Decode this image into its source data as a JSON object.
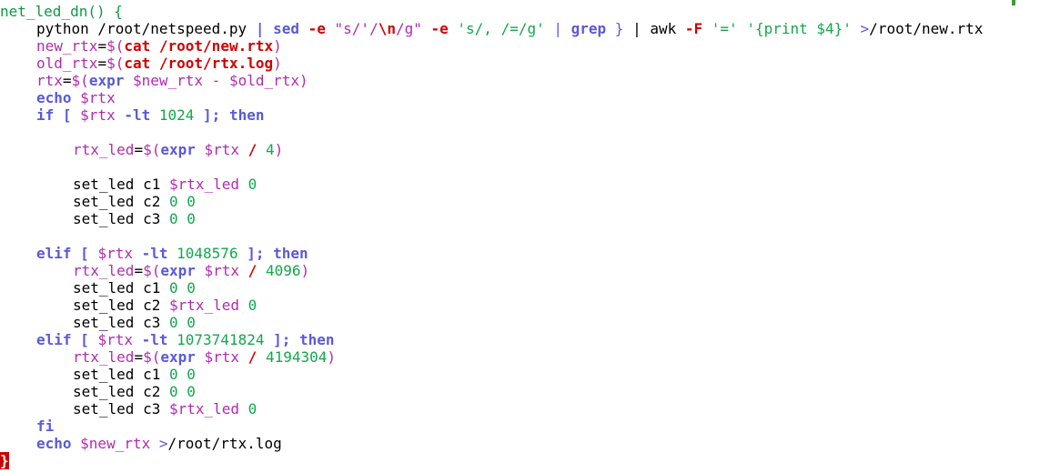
{
  "palette": {
    "background": "#ffffff",
    "default_text": "#000000",
    "function_name": "#119944",
    "keyword_command": "#5a5ad8",
    "variable": "#b02cb0",
    "string_literal": "#11a84d",
    "number": "#11a84d",
    "special_path": "#d10000",
    "cursor_background": "#cc0000"
  },
  "editor": {
    "lines": [
      {
        "indent": 0,
        "tokens": [
          [
            "net_led_dn() {",
            "function_name",
            false
          ]
        ]
      },
      {
        "indent": 4,
        "tokens": [
          [
            "python /root/netspeed.py ",
            "default_text",
            false
          ],
          [
            "| ",
            "keyword_command",
            true
          ],
          [
            "sed",
            "keyword_command",
            true
          ],
          [
            " -e ",
            "special_path",
            true
          ],
          [
            "\"s/'/",
            "variable",
            false
          ],
          [
            "\\n",
            "special_path",
            true
          ],
          [
            "/g\"",
            "variable",
            false
          ],
          [
            " -e ",
            "special_path",
            true
          ],
          [
            "'s/, /=/g'",
            "string_literal",
            false
          ],
          [
            " | ",
            "keyword_command",
            false
          ],
          [
            "grep",
            "keyword_command",
            true
          ],
          [
            " } ",
            "keyword_command",
            false
          ],
          [
            "| awk ",
            "default_text",
            false
          ],
          [
            "-F",
            "special_path",
            true
          ],
          [
            " '=' ",
            "string_literal",
            false
          ],
          [
            "'{print $4}'",
            "string_literal",
            false
          ],
          [
            " >",
            "keyword_command",
            false
          ],
          [
            "/root/new.rtx",
            "default_text",
            false
          ]
        ]
      },
      {
        "indent": 4,
        "tokens": [
          [
            "new_rtx",
            "variable",
            false
          ],
          [
            "=",
            "default_text",
            false
          ],
          [
            "$(",
            "variable",
            false
          ],
          [
            "cat",
            "special_path",
            true
          ],
          [
            " /root/new.rtx",
            "special_path",
            true
          ],
          [
            ")",
            "variable",
            false
          ]
        ]
      },
      {
        "indent": 4,
        "tokens": [
          [
            "old_rtx",
            "variable",
            false
          ],
          [
            "=",
            "default_text",
            false
          ],
          [
            "$(",
            "variable",
            false
          ],
          [
            "cat",
            "special_path",
            true
          ],
          [
            " /root/rtx.log",
            "special_path",
            true
          ],
          [
            ")",
            "variable",
            false
          ]
        ]
      },
      {
        "indent": 4,
        "tokens": [
          [
            "rtx",
            "variable",
            false
          ],
          [
            "=",
            "default_text",
            false
          ],
          [
            "$(",
            "variable",
            false
          ],
          [
            "expr",
            "keyword_command",
            true
          ],
          [
            " $new_rtx - $old_rtx)",
            "variable",
            false
          ]
        ]
      },
      {
        "indent": 4,
        "tokens": [
          [
            "echo",
            "keyword_command",
            true
          ],
          [
            " $rtx",
            "variable",
            false
          ]
        ]
      },
      {
        "indent": 4,
        "tokens": [
          [
            "if [ ",
            "keyword_command",
            true
          ],
          [
            "$rtx",
            "variable",
            false
          ],
          [
            " -lt ",
            "keyword_command",
            true
          ],
          [
            "1024",
            "number",
            false
          ],
          [
            " ]; then",
            "keyword_command",
            true
          ]
        ]
      },
      {
        "indent": 0,
        "tokens": []
      },
      {
        "indent": 8,
        "tokens": [
          [
            "rtx_led",
            "variable",
            false
          ],
          [
            "=",
            "default_text",
            false
          ],
          [
            "$(",
            "variable",
            false
          ],
          [
            "expr",
            "keyword_command",
            true
          ],
          [
            " $rtx ",
            "variable",
            false
          ],
          [
            "/",
            "special_path",
            true
          ],
          [
            " 4",
            "number",
            false
          ],
          [
            ")",
            "variable",
            false
          ]
        ]
      },
      {
        "indent": 0,
        "tokens": []
      },
      {
        "indent": 8,
        "tokens": [
          [
            "set_led c1 ",
            "default_text",
            false
          ],
          [
            "$rtx_led",
            "variable",
            false
          ],
          [
            " 0",
            "number",
            false
          ]
        ]
      },
      {
        "indent": 8,
        "tokens": [
          [
            "set_led c2 ",
            "default_text",
            false
          ],
          [
            "0 0",
            "number",
            false
          ]
        ]
      },
      {
        "indent": 8,
        "tokens": [
          [
            "set_led c3 ",
            "default_text",
            false
          ],
          [
            "0 0",
            "number",
            false
          ]
        ]
      },
      {
        "indent": 0,
        "tokens": []
      },
      {
        "indent": 4,
        "tokens": [
          [
            "elif [ ",
            "keyword_command",
            true
          ],
          [
            "$rtx",
            "variable",
            false
          ],
          [
            " -lt ",
            "keyword_command",
            true
          ],
          [
            "1048576",
            "number",
            false
          ],
          [
            " ]; then",
            "keyword_command",
            true
          ]
        ]
      },
      {
        "indent": 8,
        "tokens": [
          [
            "rtx_led",
            "variable",
            false
          ],
          [
            "=",
            "default_text",
            false
          ],
          [
            "$(",
            "variable",
            false
          ],
          [
            "expr",
            "keyword_command",
            true
          ],
          [
            " $rtx ",
            "variable",
            false
          ],
          [
            "/",
            "special_path",
            true
          ],
          [
            " 4096",
            "number",
            false
          ],
          [
            ")",
            "variable",
            false
          ]
        ]
      },
      {
        "indent": 8,
        "tokens": [
          [
            "set_led c1 ",
            "default_text",
            false
          ],
          [
            "0 0",
            "number",
            false
          ]
        ]
      },
      {
        "indent": 8,
        "tokens": [
          [
            "set_led c2 ",
            "default_text",
            false
          ],
          [
            "$rtx_led",
            "variable",
            false
          ],
          [
            " 0",
            "number",
            false
          ]
        ]
      },
      {
        "indent": 8,
        "tokens": [
          [
            "set_led c3 ",
            "default_text",
            false
          ],
          [
            "0 0",
            "number",
            false
          ]
        ]
      },
      {
        "indent": 4,
        "tokens": [
          [
            "elif [ ",
            "keyword_command",
            true
          ],
          [
            "$rtx",
            "variable",
            false
          ],
          [
            " -lt ",
            "keyword_command",
            true
          ],
          [
            "1073741824",
            "number",
            false
          ],
          [
            " ]; then",
            "keyword_command",
            true
          ]
        ]
      },
      {
        "indent": 8,
        "tokens": [
          [
            "rtx_led",
            "variable",
            false
          ],
          [
            "=",
            "default_text",
            false
          ],
          [
            "$(",
            "variable",
            false
          ],
          [
            "expr",
            "keyword_command",
            true
          ],
          [
            " $rtx ",
            "variable",
            false
          ],
          [
            "/",
            "special_path",
            true
          ],
          [
            " 4194304",
            "number",
            false
          ],
          [
            ")",
            "variable",
            false
          ]
        ]
      },
      {
        "indent": 8,
        "tokens": [
          [
            "set_led c1 ",
            "default_text",
            false
          ],
          [
            "0 0",
            "number",
            false
          ]
        ]
      },
      {
        "indent": 8,
        "tokens": [
          [
            "set_led c2 ",
            "default_text",
            false
          ],
          [
            "0 0",
            "number",
            false
          ]
        ]
      },
      {
        "indent": 8,
        "tokens": [
          [
            "set_led c3 ",
            "default_text",
            false
          ],
          [
            "$rtx_led",
            "variable",
            false
          ],
          [
            " 0",
            "number",
            false
          ]
        ]
      },
      {
        "indent": 4,
        "tokens": [
          [
            "fi",
            "keyword_command",
            true
          ]
        ]
      },
      {
        "indent": 4,
        "tokens": [
          [
            "echo",
            "keyword_command",
            true
          ],
          [
            " $new_rtx",
            "variable",
            false
          ],
          [
            " >",
            "keyword_command",
            false
          ],
          [
            "/root/rtx.log",
            "default_text",
            false
          ]
        ]
      },
      {
        "indent": 0,
        "tokens": [
          [
            "}",
            "cursor",
            true
          ]
        ]
      }
    ]
  }
}
